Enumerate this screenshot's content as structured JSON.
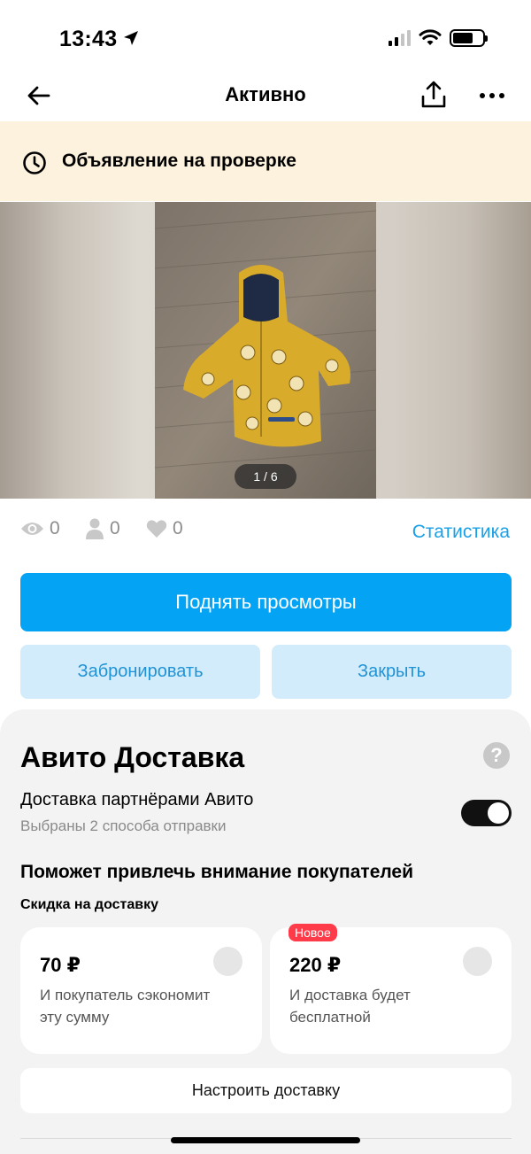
{
  "status_bar": {
    "time": "13:43",
    "signal_bars_active": 2,
    "battery_level": 0.7
  },
  "nav": {
    "title": "Активно",
    "back_icon": "arrow-left-icon",
    "share_icon": "share-icon",
    "more_icon": "more-dots-icon"
  },
  "review_banner": {
    "text": "Объявление на проверке",
    "icon": "clock-icon",
    "background": "#fdf2dd"
  },
  "photo": {
    "counter": "1 / 6",
    "current": 1,
    "total": 6
  },
  "stats": {
    "views": "0",
    "contacts": "0",
    "favorites": "0",
    "link_label": "Статистика"
  },
  "actions": {
    "primary": "Поднять просмотры",
    "reserve": "Забронировать",
    "close": "Закрыть"
  },
  "delivery": {
    "title": "Авито Доставка",
    "partner_label": "Доставка партнёрами Авито",
    "partner_sub": "Выбраны 2 способа отправки",
    "toggle_on": true,
    "attract_title": "Поможет привлечь внимание покупателей",
    "discount_label": "Скидка на доставку",
    "offers": [
      {
        "price": "70 ₽",
        "description": "И покупатель сэкономит эту сумму",
        "badge": ""
      },
      {
        "price": "220 ₽",
        "description": "И доставка будет бесплатной",
        "badge": "Новое"
      }
    ],
    "setup_button": "Настроить доставку"
  },
  "colors": {
    "accent": "#04a3f4",
    "link": "#1aa0e6",
    "secondary_bg": "#d2ecfb",
    "badge": "#ff3b4a"
  }
}
